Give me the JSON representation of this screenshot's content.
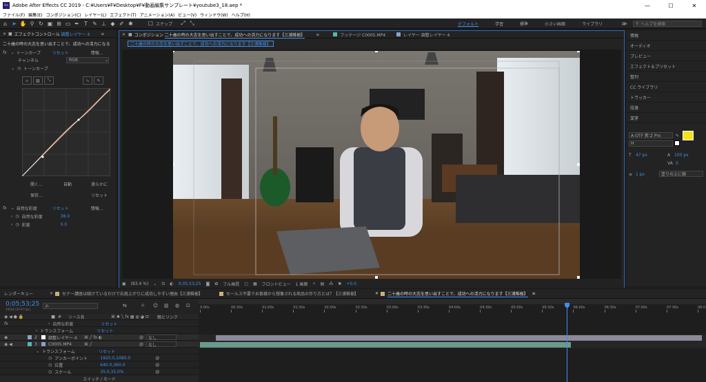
{
  "window": {
    "app_logo": "Ae",
    "title": "Adobe After Effects CC 2019 - C:¥Users¥F¥Desktop¥F¥動画編集サンプレート¥youtube3_18.aep *",
    "minimize": "—",
    "maximize": "☐",
    "close": "✕"
  },
  "menu": [
    "ファイル(F)",
    "編集(E)",
    "コンポジション(C)",
    "レイヤー(L)",
    "エフェクト(T)",
    "アニメーション(A)",
    "ビュー(V)",
    "ウィンドウ(W)",
    "ヘルプ(H)"
  ],
  "toolbar": {
    "snap_label": "スナップ",
    "workspaces": [
      "デフォルト",
      "学習",
      "標準",
      "小さい画面",
      "ライブラリ"
    ],
    "active_workspace": 0,
    "help_placeholder": "ヘルプを検索"
  },
  "effect_controls": {
    "tab_label": "エフェクトコントロール",
    "tab_layer": "調整レイヤー 4",
    "layer_path": "二十歳の時の大志を思い出すことで、成功への活力になる",
    "fx_curves": "トーンカーブ",
    "reset": "リセット",
    "about": "情報...",
    "channel_label": "チャンネル",
    "channel_value": "RGB",
    "curves_sub": "トーンカーブ",
    "btn_open": "開く...",
    "btn_auto": "自動",
    "btn_smooth": "滑らかに",
    "btn_save": "保存...",
    "btn_reset": "リセット",
    "fx_vibrance": "自然な彩度",
    "vibrance_label": "自然な彩度",
    "vibrance_value": "38.0",
    "saturation_label": "彩度",
    "saturation_value": "0.0"
  },
  "composition": {
    "tab_comp_prefix": "コンポジション",
    "tab_comp_name": "二十歳の時の大志を思い出すことで、成功への活力になります【三浦椎樹】",
    "tab_footage": "フッテージ C0005.MP4",
    "tab_layer": "レイヤー 調整レイヤー 4",
    "breadcrumb": "二十歳の時の大志を思い出すことで、成功への活力になります【三浦椎樹】",
    "zoom": "(83.4 %)",
    "timecode": "0;05;53;25",
    "resolution": "フル画質",
    "view": "フロントビュー",
    "views_count": "1 画面",
    "exposure": "+0.0"
  },
  "right_panels": {
    "items": [
      "情報",
      "オーディオ",
      "プレビュー",
      "エフェクト＆プリセット",
      "整列",
      "CC ライブラリ",
      "トラッカー",
      "段落",
      "文字"
    ],
    "font_family": "A-OTF 新ゴ Pro",
    "font_style": "H",
    "font_size": "47 px",
    "leading": "100 px",
    "tracking": "0",
    "stroke_width": "1 px",
    "stroke_type": "塗りの上に線",
    "fill_color": "#f1e21d",
    "stroke_color": "#ffffff"
  },
  "timeline": {
    "render_tab": "レンダーキュー",
    "tabs": [
      {
        "label": "セナー講座は続けているだけで右肩上がりに成功しやすい理由【三浦椎樹】",
        "color": "#c8b27a"
      },
      {
        "label": "セールス不要でお客様から想像される商品の作り方とは？【三浦椎樹】",
        "color": "#c8b27a"
      },
      {
        "label": "二十歳の時の大志を思い出すことで、成功への活力になります【三浦椎樹】",
        "color": "#c8b27a"
      }
    ],
    "active_tab": 2,
    "timecode": "0;05;53;25",
    "timecode_sub": "10618 (29.97 fps)",
    "search_placeholder": "ρ.",
    "columns": {
      "source": "ソース名",
      "parent": "親とリンク"
    },
    "rows": [
      {
        "label": "自然な彩度",
        "value": "リセット",
        "indent": 70
      },
      {
        "label": "トランスフォーム",
        "value": "リセット",
        "indent": 52
      },
      {
        "num": "2",
        "label": "調整レイヤー 4",
        "parent": "なし",
        "indent": 84
      },
      {
        "num": "3",
        "label": "C0005.MP4",
        "parent": "なし",
        "indent": 84
      },
      {
        "label": "トランスフォーム",
        "value": "リセット",
        "indent": 60
      },
      {
        "label": "アンカーポイント",
        "value": "1920.0,1080.0",
        "indent": 80
      },
      {
        "label": "位置",
        "value": "640.0,360.0",
        "indent": 80
      },
      {
        "label": "スケール",
        "value": "35.0,35.0%",
        "indent": 80
      }
    ],
    "switch_mode": "スイッチ / モード",
    "ruler": [
      "0:00s",
      "00:30s",
      "01:00s",
      "01:30s",
      "02:00s",
      "02:30s",
      "03:00s",
      "03:30s",
      "04:00s",
      "04:30s",
      "05:00s",
      "05:30s",
      "06:00s",
      "06:30s",
      "07:00s",
      "07:30s",
      "08:0"
    ],
    "playhead_seconds": 353.8,
    "ruler_max_seconds": 484,
    "layer2_bar": {
      "start": 15,
      "end": 484
    },
    "layer3_bar": {
      "start": 0,
      "end": 358
    }
  }
}
